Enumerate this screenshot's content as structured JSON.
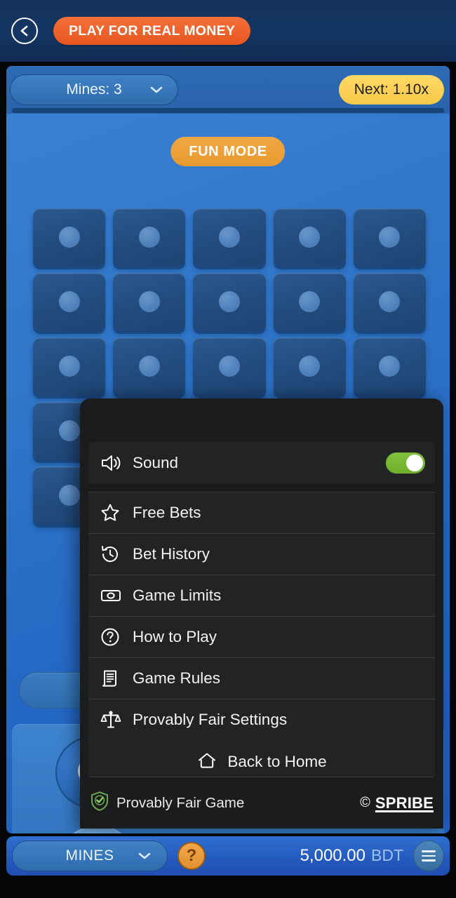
{
  "header": {
    "back_icon": "chevron-left-icon",
    "real_money_label": "PLAY FOR REAL MONEY"
  },
  "status_bar": {
    "mines_select_label": "Mines: 3",
    "mines_select_icon": "chevron-down-icon",
    "next_multiplier_label": "Next: 1.10x"
  },
  "game": {
    "fun_mode_label": "FUN MODE",
    "grid": {
      "rows": 5,
      "columns": 5,
      "tiles": 25
    },
    "autoplay_icon": "autoplay-refresh-icon"
  },
  "menu": {
    "sound": {
      "label": "Sound",
      "icon": "speaker-icon",
      "toggle_on": true
    },
    "items": [
      {
        "label": "Free Bets",
        "icon": "star-icon"
      },
      {
        "label": "Bet History",
        "icon": "history-clock-icon"
      },
      {
        "label": "Game Limits",
        "icon": "banknote-icon"
      },
      {
        "label": "How to Play",
        "icon": "question-circle-icon"
      },
      {
        "label": "Game Rules",
        "icon": "document-scroll-icon"
      },
      {
        "label": "Provably Fair Settings",
        "icon": "scales-icon"
      }
    ],
    "back_home": {
      "label": "Back to Home",
      "icon": "home-icon"
    },
    "footer": {
      "fair_label": "Provably Fair Game",
      "fair_icon": "shield-check-icon",
      "copyright_mark": "©",
      "brand": "SPRIBE"
    }
  },
  "bottom_bar": {
    "game_name": "MINES",
    "game_name_icon": "chevron-down-icon",
    "help_label": "?",
    "balance_amount": "5,000.00",
    "balance_currency": "BDT",
    "menu_icon": "hamburger-icon"
  },
  "colors": {
    "accent_orange": "#e8561f",
    "fun_mode": "#e8992f",
    "next_yellow": "#f6c949",
    "toggle_green": "#6fae2c",
    "panel_bg": "#1b1c1e",
    "row_bg": "#222325",
    "game_blue": "#2f75c8"
  }
}
